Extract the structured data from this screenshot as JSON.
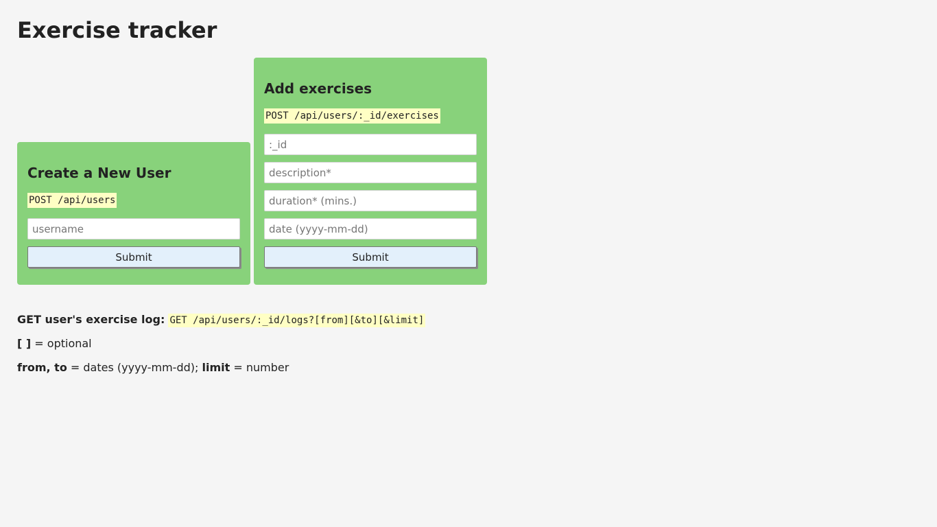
{
  "page": {
    "title": "Exercise tracker"
  },
  "create_user": {
    "heading": "Create a New User",
    "endpoint": "POST /api/users",
    "username_placeholder": "username",
    "submit_label": "Submit"
  },
  "add_exercise": {
    "heading": "Add exercises",
    "endpoint": "POST /api/users/:_id/exercises",
    "id_placeholder": ":_id",
    "description_placeholder": "description*",
    "duration_placeholder": "duration* (mins.)",
    "date_placeholder": "date (yyyy-mm-dd)",
    "submit_label": "Submit"
  },
  "footer": {
    "get_label": "GET user's exercise log:",
    "get_endpoint": "GET /api/users/:_id/logs?[from][&to][&limit]",
    "optional_symbol": "[ ]",
    "optional_text": " = optional",
    "params_from_to": "from, to",
    "params_dates_text": " = dates (yyyy-mm-dd); ",
    "params_limit": "limit",
    "params_limit_text": " = number"
  },
  "colors": {
    "card_background": "#88d27b",
    "code_highlight": "#ffffc4",
    "button_background": "#e3f0fb",
    "page_background": "#f5f5f5"
  }
}
